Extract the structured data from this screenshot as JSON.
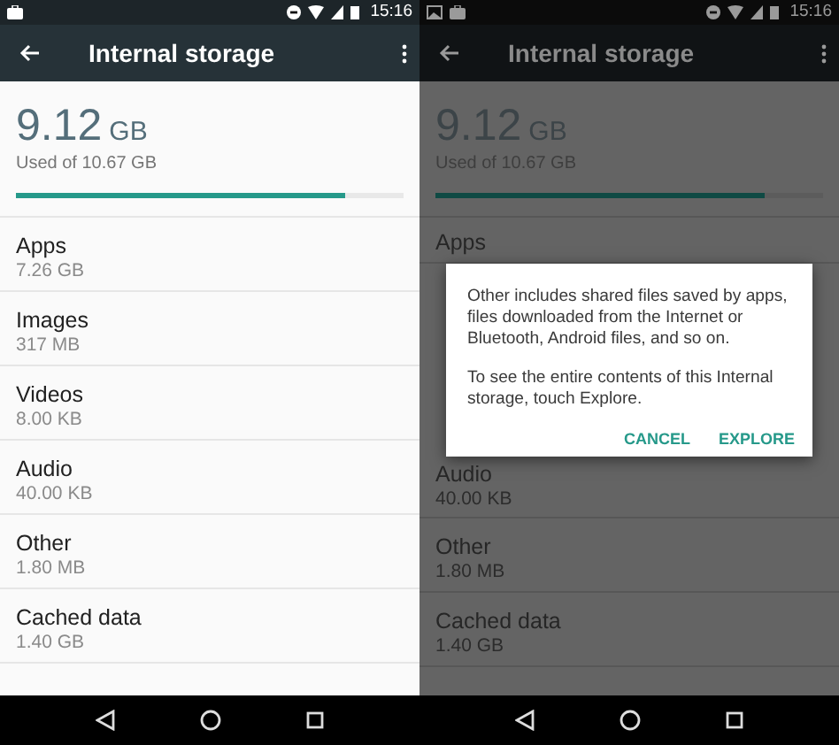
{
  "screens": [
    {
      "dimmed": false,
      "status_bar": {
        "time": "15:16"
      },
      "toolbar": {
        "title": "Internal storage"
      },
      "summary": {
        "used": "9.12",
        "unit": "GB",
        "caption": "Used of 10.67 GB",
        "level": 0.85
      },
      "rows_above": [
        {
          "label": "Apps",
          "value": "7.26 GB"
        },
        {
          "label": "Images",
          "value": "317 MB"
        },
        {
          "label": "Videos",
          "value": "8.00 KB"
        }
      ],
      "rows_below": [
        {
          "label": "Audio",
          "value": "40.00 KB"
        },
        {
          "label": "Other",
          "value": "1.80 MB"
        },
        {
          "label": "Cached data",
          "value": "1.40 GB"
        }
      ]
    },
    {
      "dimmed": true,
      "status_bar": {
        "time": "15:16"
      },
      "toolbar": {
        "title": "Internal storage"
      },
      "summary": {
        "used": "9.12",
        "unit": "GB",
        "caption": "Used of 10.67 GB",
        "level": 0.85
      },
      "rows_above": [
        {
          "label": "Apps"
        }
      ],
      "dialog": {
        "paragraphs": [
          "Other includes shared files saved by apps, files downloaded from the Internet or Bluetooth, Android files, and so on.",
          "To see the entire contents of this Internal storage, touch Explore."
        ],
        "buttons": [
          "CANCEL",
          "EXPLORE"
        ]
      },
      "rows_below": [
        {
          "label": "Audio",
          "value": "40.00 KB"
        },
        {
          "label": "Other",
          "value": "1.80 MB"
        },
        {
          "label": "Cached data",
          "value": "1.40 GB"
        }
      ]
    }
  ]
}
